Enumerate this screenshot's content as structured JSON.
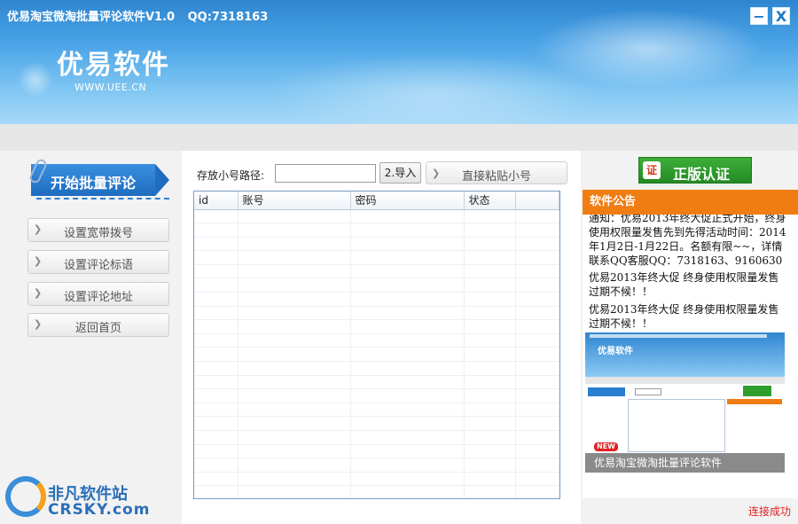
{
  "window": {
    "title": "优易淘宝微淘批量评论软件V1.0",
    "qq": "QQ:7318163",
    "min_label": "−",
    "close_label": "X"
  },
  "brand": {
    "name": "优易软件",
    "url": "WWW.UEE.CN"
  },
  "nav": {
    "start_label": "开始批量评论",
    "items": [
      {
        "label": "设置宽带拨号"
      },
      {
        "label": "设置评论标语"
      },
      {
        "label": "设置评论地址"
      },
      {
        "label": "返回首页"
      }
    ]
  },
  "toolbar": {
    "path_label": "存放小号路径:",
    "path_value": "",
    "import_label": "2.导入",
    "paste_label": "直接粘贴小号"
  },
  "table": {
    "columns": [
      "id",
      "账号",
      "密码",
      "状态",
      ""
    ],
    "rows": []
  },
  "right": {
    "auth_label": "正版认证",
    "auth_icon": "certificate-icon",
    "notice_title": "软件公告",
    "notices": [
      "通知：优易2013年终大促正式开始，终身使用权限量发售先到先得活动时间：2014年1月2日-1月22日。名额有限~~，详情联系QQ客服QQ：7318163、9160630",
      "优易2013年终大促  终身使用权限量发售过期不候！！",
      "优易2013年终大促  终身使用权限量发售过期不候！！"
    ],
    "ad": {
      "brand": "优易软件",
      "badge": "NEW",
      "caption": "优易淘宝微淘批量评论软件"
    },
    "status": "连接成功"
  },
  "watermark": {
    "line1": "非凡软件站",
    "line2": "CRSKY.com"
  },
  "colors": {
    "header_blue": "#2f86d0",
    "notice_orange": "#f07d12",
    "auth_green": "#238a23",
    "status_red": "#e02020"
  }
}
